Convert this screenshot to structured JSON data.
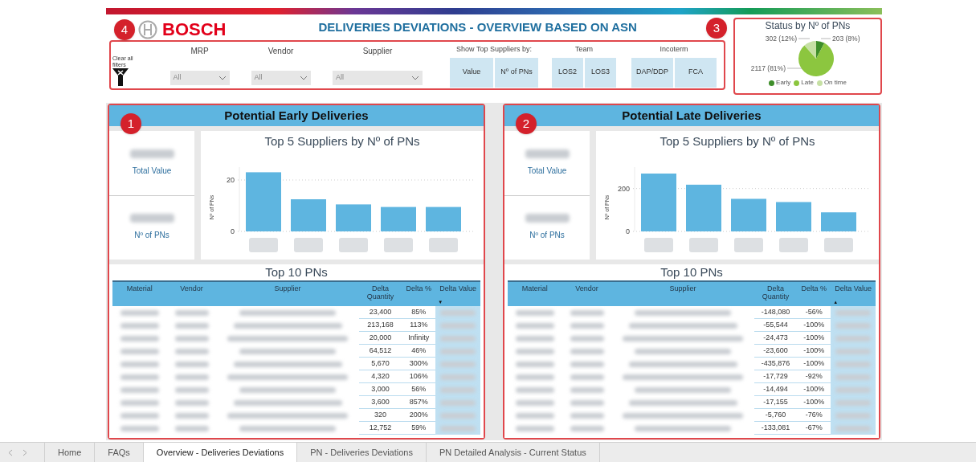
{
  "header": {
    "logo": "BOSCH",
    "title": "DELIVERIES DEVIATIONS - OVERVIEW BASED ON ASN"
  },
  "filters": {
    "marker": "4",
    "clear_label": "Clear all filters",
    "dropdowns": [
      {
        "label": "MRP",
        "value": "All"
      },
      {
        "label": "Vendor",
        "value": "All"
      },
      {
        "label": "Supplier",
        "value": "All"
      }
    ],
    "button_groups": [
      {
        "label": "Show Top Suppliers by:",
        "options": [
          "Value",
          "Nº of PNs"
        ]
      },
      {
        "label": "Team",
        "options": [
          "LOS2",
          "LOS3"
        ]
      },
      {
        "label": "Incoterm",
        "options": [
          "DAP/DDP",
          "FCA"
        ]
      }
    ]
  },
  "status": {
    "marker": "3",
    "chart_data": {
      "type": "pie",
      "title": "Status by Nº of PNs",
      "categories": [
        "Early",
        "Late",
        "On time"
      ],
      "colors": [
        "#3e8e2a",
        "#8cc63f",
        "#c6e0a4"
      ],
      "values": [
        203,
        2117,
        302
      ],
      "value_labels": [
        "203 (8%)",
        "2117 (81%)",
        "302 (12%)"
      ]
    }
  },
  "panels": [
    {
      "marker": "1",
      "title": "Potential Early Deliveries",
      "kpis": [
        "Total Value",
        "Nº of PNs"
      ],
      "chart": {
        "title": "Top 5 Suppliers by Nº of PNs",
        "chart_data": {
          "type": "bar",
          "ylabel": "Nº of PNs",
          "values": [
            23,
            12.5,
            10.5,
            9.5,
            9.5
          ],
          "ylim": [
            0,
            25
          ],
          "yticks": [
            0,
            20
          ]
        }
      },
      "table": {
        "title": "Top 10 PNs",
        "columns": [
          {
            "label": "Material"
          },
          {
            "label": "Vendor"
          },
          {
            "label": "Supplier"
          },
          {
            "label": "Delta Quantity"
          },
          {
            "label": "Delta %"
          },
          {
            "label": "Delta Value",
            "sort_indicator": "▼"
          }
        ],
        "rows": [
          {
            "delta_quantity": "23,400",
            "delta_percent": "85%"
          },
          {
            "delta_quantity": "213,168",
            "delta_percent": "113%"
          },
          {
            "delta_quantity": "20,000",
            "delta_percent": "Infinity"
          },
          {
            "delta_quantity": "64,512",
            "delta_percent": "46%"
          },
          {
            "delta_quantity": "5,670",
            "delta_percent": "300%"
          },
          {
            "delta_quantity": "4,320",
            "delta_percent": "106%"
          },
          {
            "delta_quantity": "3,000",
            "delta_percent": "56%"
          },
          {
            "delta_quantity": "3,600",
            "delta_percent": "857%"
          },
          {
            "delta_quantity": "320",
            "delta_percent": "200%"
          },
          {
            "delta_quantity": "12,752",
            "delta_percent": "59%"
          }
        ]
      }
    },
    {
      "marker": "2",
      "title": "Potential Late Deliveries",
      "kpis": [
        "Total Value",
        "Nº of PNs"
      ],
      "chart": {
        "title": "Top 5 Suppliers by Nº of PNs",
        "chart_data": {
          "type": "bar",
          "ylabel": "Nº of PNs",
          "values": [
            270,
            218,
            152,
            137,
            89
          ],
          "ylim": [
            0,
            300
          ],
          "yticks": [
            0,
            200
          ]
        }
      },
      "table": {
        "title": "Top 10 PNs",
        "columns": [
          {
            "label": "Material"
          },
          {
            "label": "Vendor"
          },
          {
            "label": "Supplier"
          },
          {
            "label": "Delta Quantity"
          },
          {
            "label": "Delta %"
          },
          {
            "label": "Delta Value",
            "sort_indicator": "▲"
          }
        ],
        "rows": [
          {
            "delta_quantity": "-148,080",
            "delta_percent": "-56%"
          },
          {
            "delta_quantity": "-55,544",
            "delta_percent": "-100%"
          },
          {
            "delta_quantity": "-24,473",
            "delta_percent": "-100%"
          },
          {
            "delta_quantity": "-23,600",
            "delta_percent": "-100%"
          },
          {
            "delta_quantity": "-435,876",
            "delta_percent": "-100%"
          },
          {
            "delta_quantity": "-17,729",
            "delta_percent": "-92%"
          },
          {
            "delta_quantity": "-14,494",
            "delta_percent": "-100%"
          },
          {
            "delta_quantity": "-17,155",
            "delta_percent": "-100%"
          },
          {
            "delta_quantity": "-5,760",
            "delta_percent": "-76%"
          },
          {
            "delta_quantity": "-133,081",
            "delta_percent": "-67%"
          }
        ]
      }
    }
  ],
  "tabs": [
    {
      "label": "Home",
      "selected": false
    },
    {
      "label": "FAQs",
      "selected": false
    },
    {
      "label": "Overview - Deliveries Deviations",
      "selected": true
    },
    {
      "label": "PN - Deliveries Deviations",
      "selected": false
    },
    {
      "label": "PN Detailed Analysis - Current Status",
      "selected": false
    }
  ]
}
